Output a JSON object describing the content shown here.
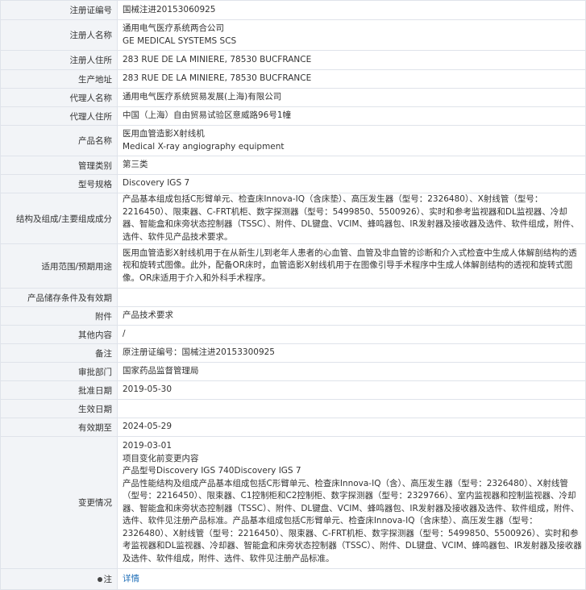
{
  "rows": [
    {
      "label": "注册证编号",
      "value": "国械注进20153060925"
    },
    {
      "label": "注册人名称",
      "value": "通用电气医疗系统两合公司\nGE MEDICAL SYSTEMS SCS"
    },
    {
      "label": "注册人住所",
      "value": "283 RUE DE LA MINIERE, 78530 BUCFRANCE"
    },
    {
      "label": "生产地址",
      "value": "283 RUE DE LA MINIERE, 78530 BUCFRANCE"
    },
    {
      "label": "代理人名称",
      "value": "通用电气医疗系统贸易发展(上海)有限公司"
    },
    {
      "label": "代理人住所",
      "value": "中国（上海）自由贸易试验区意威路96号1幢"
    },
    {
      "label": "产品名称",
      "value": "医用血管造影X射线机\nMedical X-ray angiography equipment"
    },
    {
      "label": "管理类别",
      "value": "第三类"
    },
    {
      "label": "型号规格",
      "value": "Discovery IGS 7"
    },
    {
      "label": "结构及组成/主要组成成分",
      "value": "产品基本组成包括C形臂单元、检查床Innova-IQ（含床垫）、高压发生器（型号：2326480）、X射线管（型号：2216450）、限束器、C-FRT机柜、数字探测器（型号：5499850、5500926）、实时和参考监视器和DL监视器、冷却器、智能盒和床旁状态控制器（TSSC）、附件、DL键盘、VCIM、蜂鸣器包、IR发射器及接收器及选件、软件组成，附件、选件、软件见产品技术要求。"
    },
    {
      "label": "适用范围/预期用途",
      "value": "医用血管造影X射线机用于在从新生儿到老年人患者的心血管、血管及非血管的诊断和介入式检查中生成人体解剖结构的透视和旋转式图像。此外，配备OR床时，血管造影X射线机用于在图像引导手术程序中生成人体解剖结构的透视和旋转式图像。OR床适用于介入和外科手术程序。"
    },
    {
      "label": "产品储存条件及有效期",
      "value": ""
    },
    {
      "label": "附件",
      "value": "产品技术要求"
    },
    {
      "label": "其他内容",
      "value": "/"
    },
    {
      "label": "备注",
      "value": "原注册证编号：国械注进20153300925"
    },
    {
      "label": "审批部门",
      "value": "国家药品监督管理局"
    },
    {
      "label": "批准日期",
      "value": "2019-05-30"
    },
    {
      "label": "生效日期",
      "value": ""
    },
    {
      "label": "有效期至",
      "value": "2024-05-29"
    },
    {
      "label": "变更情况",
      "value": "2019-03-01\n项目变化前变更内容\n产品型号Discovery IGS 740Discovery IGS 7\n产品性能结构及组成产品基本组成包括C形臂单元、检查床Innova-IQ（含）、高压发生器（型号：2326480）、X射线管（型号：2216450）、限束器、C1控制柜和C2控制柜、数字探测器（型号：2329766）、室内监视器和控制监视器、冷却器、智能盒和床旁状态控制器（TSSC）、附件、DL键盘、VCIM、蜂鸣器包、IR发射器及接收器及选件、软件组成，附件、选件、软件见注册产品标准。产品基本组成包括C形臂单元、检查床Innova-IQ（含床垫）、高压发生器（型号：2326480）、X射线管（型号：2216450）、限束器、C-FRT机柜、数字探测器（型号：5499850、5500926）、实时和参考监视器和DL监视器、冷却器、智能盒和床旁状态控制器（TSSC）、附件、DL键盘、VCIM、蜂鸣器包、IR发射器及接收器及选件、软件组成，附件、选件、软件见注册产品标准。"
    }
  ],
  "note": {
    "label": "注",
    "link": "详情"
  }
}
